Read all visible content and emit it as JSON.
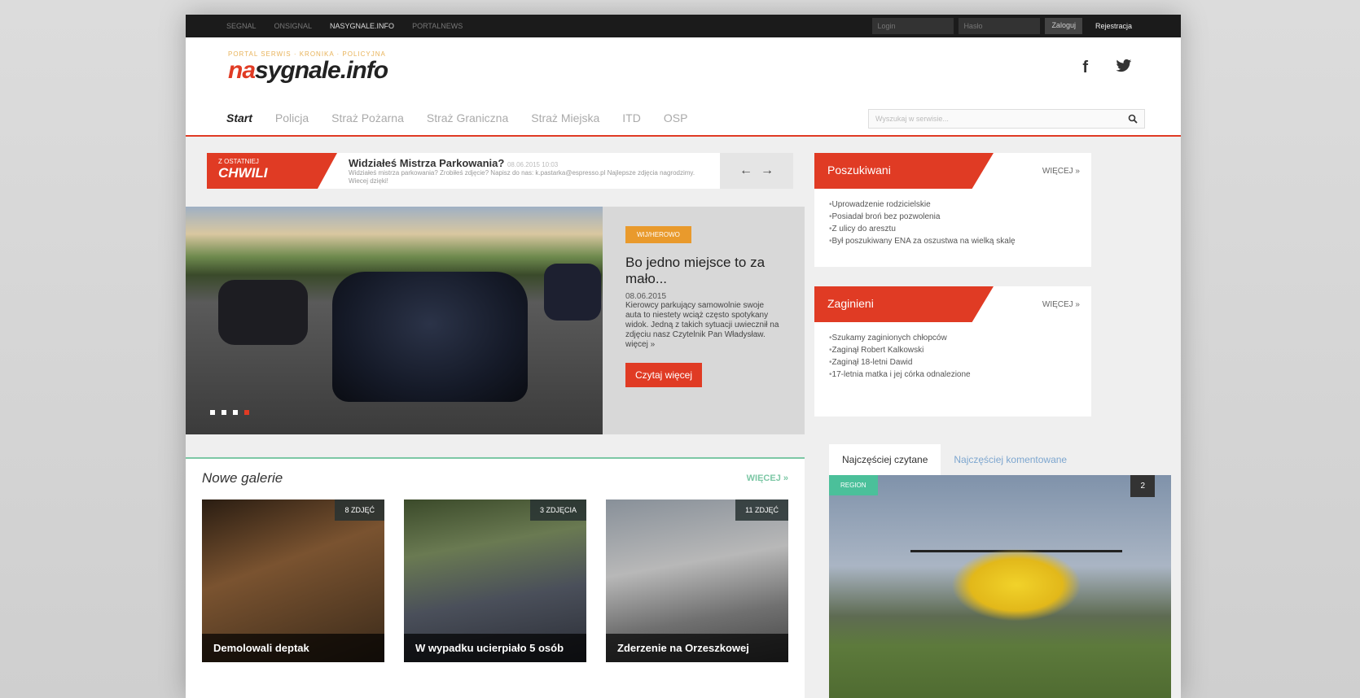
{
  "topbar": {
    "links": [
      {
        "label": "SEGNAL",
        "active": false
      },
      {
        "label": "ONSIGNAL",
        "active": false
      },
      {
        "label": "NASYGNALE.INFO",
        "active": true
      },
      {
        "label": "PORTALNEWS",
        "active": false
      }
    ],
    "login_placeholder": "Login",
    "password_placeholder": "Hasło",
    "login_button": "Zaloguj",
    "register": "Rejestracja"
  },
  "header": {
    "tagline": "PORTAL SERWIS · KRONIKA · POLICYJNA",
    "logo_na": "na",
    "logo_rest": "sygnale.info",
    "social": {
      "facebook": "f",
      "twitter": "t"
    }
  },
  "nav": {
    "items": [
      "Start",
      "Policja",
      "Straż Pożarna",
      "Straż Graniczna",
      "Straż Miejska",
      "ITD",
      "OSP"
    ],
    "search_placeholder": "Wyszukaj w serwisie..."
  },
  "ticker": {
    "badge_small": "Z OSTATNIEJ",
    "badge_big": "CHWILI",
    "title": "Widziałeś Mistrza Parkowania?",
    "date": "08.06.2015 10:03",
    "desc": "Widziałeś mistrza parkowania? Zrobiłeś zdjęcie? Napisz do nas: k.pastarka@espresso.pl Najlepsze zdjęcia nagrodzimy. Wiecej dzięki!",
    "prev": "←",
    "next": "→"
  },
  "slider": {
    "category": "WIJ/HEROWO",
    "title": "Bo jedno miejsce to za mało...",
    "date": "08.06.2015",
    "text": "Kierowcy parkujący samowolnie swoje auta to niestety wciąż często spotykany widok. Jedną z takich sytuacji uwiecznił na zdjęciu nasz Czytelnik Pan Władysław. więcej »",
    "button": "Czytaj więcej"
  },
  "galleries": {
    "title": "Nowe galerie",
    "more": "WIĘCEJ »",
    "items": [
      {
        "count": "8 ZDJĘĆ",
        "caption": "Demolowali deptak"
      },
      {
        "count": "3 ZDJĘCIA",
        "caption": "W wypadku ucierpiało 5 osób"
      },
      {
        "count": "11 ZDJĘĆ",
        "caption": "Zderzenie na Orzeszkowej"
      }
    ]
  },
  "wanted": {
    "title": "Poszukiwani",
    "more": "WIĘCEJ »",
    "items": [
      "Uprowadzenie rodzicielskie",
      "Posiadał broń bez pozwolenia",
      "Z ulicy do aresztu",
      "Był poszukiwany ENA za oszustwa na wielką skalę"
    ]
  },
  "missing": {
    "title": "Zaginieni",
    "more": "WIĘCEJ »",
    "items": [
      "Szukamy zaginionych chłopców",
      "Zaginął Robert Kalkowski",
      "Zaginął 18-letni Dawid",
      "17-letnia matka i jej córka odnalezione"
    ]
  },
  "tabs": {
    "most_read": "Najczęściej czytane",
    "most_commented": "Najczęściej komentowane"
  },
  "popular": {
    "region": "REGION",
    "number": "2"
  }
}
